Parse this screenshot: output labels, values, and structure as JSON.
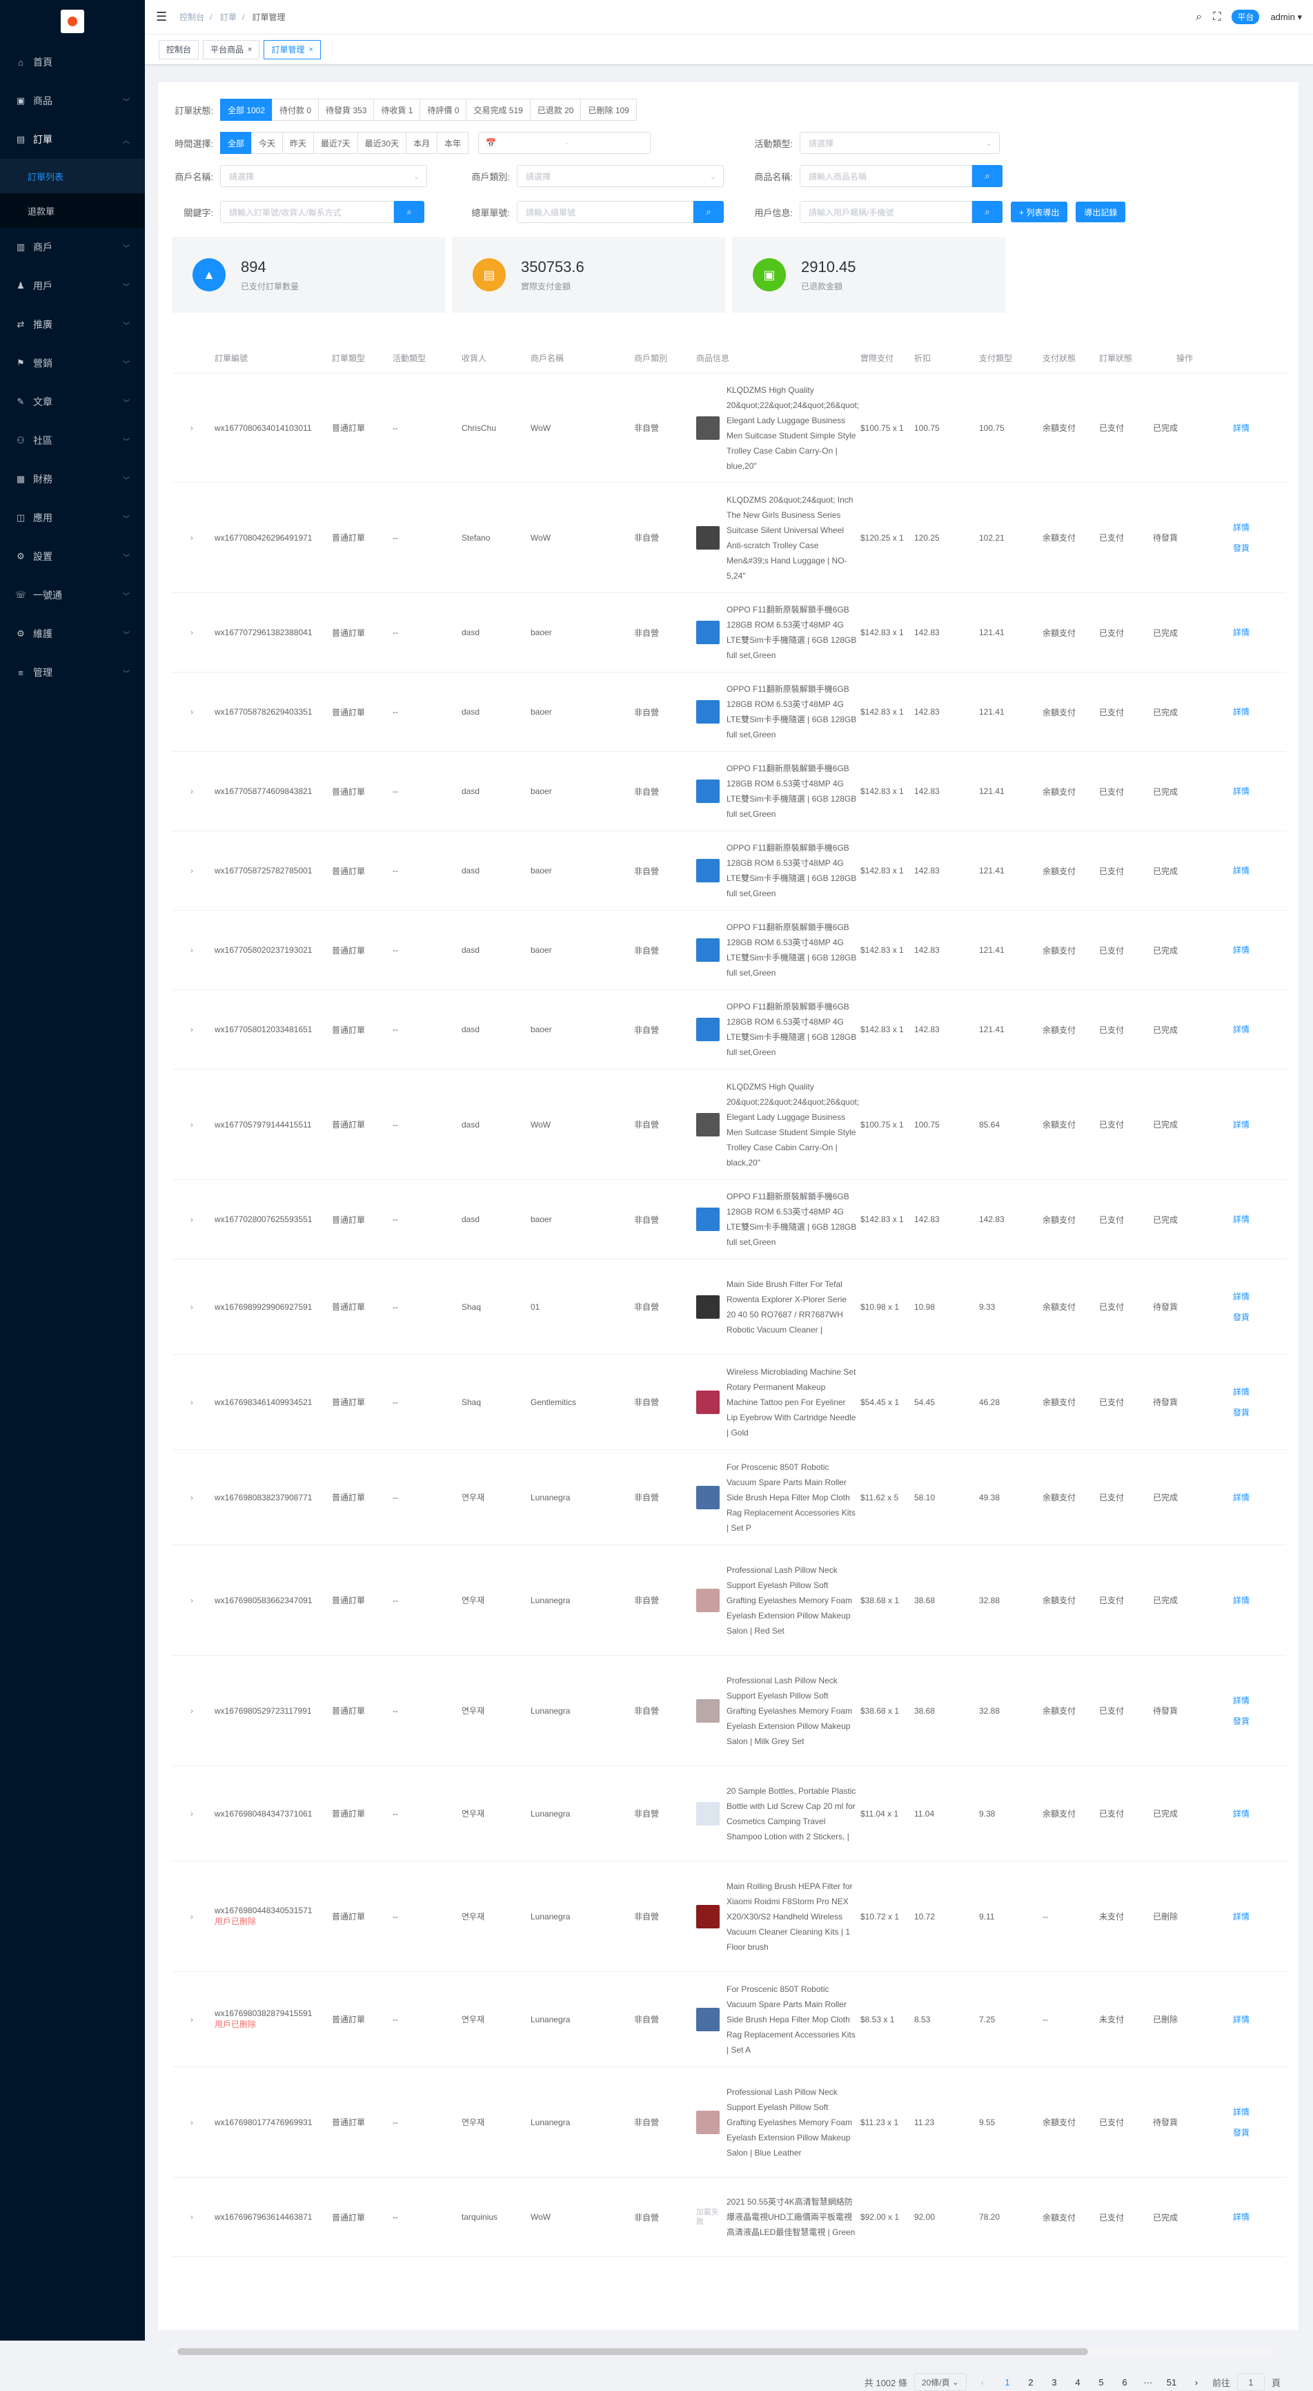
{
  "sidebar": {
    "items": [
      {
        "label": "首頁",
        "icon": "home-icon",
        "glyph": "⌂"
      },
      {
        "label": "商品",
        "icon": "goods-icon",
        "glyph": "▣"
      },
      {
        "label": "訂單",
        "icon": "order-icon",
        "glyph": "▤",
        "open": true,
        "children": [
          {
            "label": "訂單列表",
            "active": true
          },
          {
            "label": "退款單",
            "active": false
          }
        ]
      },
      {
        "label": "商戶",
        "icon": "merchant-icon",
        "glyph": "▥"
      },
      {
        "label": "用戶",
        "icon": "user-icon",
        "glyph": "♟"
      },
      {
        "label": "推廣",
        "icon": "promotion-icon",
        "glyph": "⇄"
      },
      {
        "label": "營銷",
        "icon": "marketing-icon",
        "glyph": "⚑"
      },
      {
        "label": "文章",
        "icon": "article-icon",
        "glyph": "✎"
      },
      {
        "label": "社區",
        "icon": "community-icon",
        "glyph": "⚇"
      },
      {
        "label": "財務",
        "icon": "finance-icon",
        "glyph": "▦"
      },
      {
        "label": "應用",
        "icon": "app-icon",
        "glyph": "◫"
      },
      {
        "label": "設置",
        "icon": "settings-icon",
        "glyph": "⚙"
      },
      {
        "label": "一號通",
        "icon": "phone-icon",
        "glyph": "☏"
      },
      {
        "label": "維護",
        "icon": "maintenance-icon",
        "glyph": "⚙"
      },
      {
        "label": "管理",
        "icon": "manage-icon",
        "glyph": "≡"
      }
    ]
  },
  "header": {
    "breadcrumb": [
      "控制台",
      "訂單",
      "訂單管理"
    ],
    "platform_badge": "平台",
    "username": "admin"
  },
  "tags": [
    {
      "label": "控制台",
      "closable": false,
      "active": false
    },
    {
      "label": "平台商品",
      "closable": true,
      "active": false
    },
    {
      "label": "訂單管理",
      "closable": true,
      "active": true
    }
  ],
  "filters": {
    "status_label": "訂單狀態:",
    "status_options": [
      "全部 1002",
      "待付款 0",
      "待發貨 353",
      "待收貨 1",
      "待評價 0",
      "交易完成 519",
      "已退款 20",
      "已刪除 109"
    ],
    "time_label": "時間選擇:",
    "time_options": [
      "全部",
      "今天",
      "昨天",
      "最近7天",
      "最近30天",
      "本月",
      "本年"
    ],
    "date_separator": "-",
    "activity_label": "活動類型:",
    "activity_placeholder": "請選擇",
    "merchant_label": "商戶名稱:",
    "merchant_placeholder": "請選擇",
    "merchant_cat_label": "商戶類別:",
    "merchant_cat_placeholder": "請選擇",
    "product_label": "商品名稱:",
    "product_placeholder": "請輸入商品名稱",
    "keyword_label": "關鍵字:",
    "keyword_placeholder": "請輸入訂單號/收貨人/聯系方式",
    "total_order_label": "總單單號:",
    "total_order_placeholder": "請輸入總單號",
    "user_info_label": "用戶信息:",
    "user_info_placeholder": "請輸入用戶暱稱/手機號",
    "export_list_btn": "+ 列表導出",
    "export_record_btn": "導出記錄"
  },
  "stats": [
    {
      "value": "894",
      "label": "已支付訂單數量",
      "color": "#1890ff",
      "icon": "bag-icon",
      "glyph": "▲"
    },
    {
      "value": "350753.6",
      "label": "實際支付金額",
      "color": "#f5a623",
      "icon": "wallet-icon",
      "glyph": "▤"
    },
    {
      "value": "2910.45",
      "label": "已退款金額",
      "color": "#52c41a",
      "icon": "refund-icon",
      "glyph": "▣"
    }
  ],
  "table": {
    "columns": [
      "訂單編號",
      "訂單類型",
      "活動類型",
      "收貨人",
      "商戶名稱",
      "商戶類別",
      "商品信息",
      "實際支付",
      "折扣",
      "支付類型",
      "支付狀態",
      "訂單狀態",
      "操作"
    ],
    "rows": [
      {
        "id": "wx1677080634014103011",
        "type": "普通訂單",
        "act": "--",
        "rec": "ChrisChu",
        "mer": "WoW",
        "cat": "非自營",
        "thumb": "#555",
        "info": "KLQDZMS High Quality 20&quot;22&quot;24&quot;26&quot; Elegant Lady Luggage Business Men Suitcase Student Simple Style Trolley Case Cabin Carry-On | blue,20\"",
        "price": "$100.75 x 1",
        "pay": "100.75",
        "disc": "100.75",
        "ptype": "余額支付",
        "pstat": "已支付",
        "ostat": "已完成",
        "ops": [
          "詳情"
        ],
        "h": 158
      },
      {
        "id": "wx1677080426296491971",
        "type": "普通訂單",
        "act": "--",
        "rec": "Stefano",
        "mer": "WoW",
        "cat": "非自營",
        "thumb": "#444",
        "info": "KLQDZMS 20&quot;24&quot; Inch The New Girls Business Series Suitcase Silent Universal Wheel Anti-scratch Trolley Case Men&#39;s Hand Luggage | NO-5,24\"",
        "price": "$120.25 x 1",
        "pay": "120.25",
        "disc": "102.21",
        "ptype": "余額支付",
        "pstat": "已支付",
        "ostat": "待發貨",
        "ops": [
          "詳情",
          "發貨"
        ],
        "h": 160
      },
      {
        "id": "wx1677072961382388041",
        "type": "普通訂單",
        "act": "--",
        "rec": "dasd",
        "mer": "baoer",
        "cat": "非自營",
        "thumb": "#2a7fd4",
        "info": "OPPO F11翻新原裝解鎖手機6GB 128GB ROM 6.53英寸48MP 4G LTE雙Sim卡手機隨選 | 6GB 128GB full set,Green",
        "price": "$142.83 x 1",
        "pay": "142.83",
        "disc": "121.41",
        "ptype": "余額支付",
        "pstat": "已支付",
        "ostat": "已完成",
        "ops": [
          "詳情"
        ],
        "h": 115
      },
      {
        "id": "wx1677058782629403351",
        "type": "普通訂單",
        "act": "--",
        "rec": "dasd",
        "mer": "baoer",
        "cat": "非自營",
        "thumb": "#2a7fd4",
        "info": "OPPO F11翻新原裝解鎖手機6GB 128GB ROM 6.53英寸48MP 4G LTE雙Sim卡手機隨選 | 6GB 128GB full set,Green",
        "price": "$142.83 x 1",
        "pay": "142.83",
        "disc": "121.41",
        "ptype": "余額支付",
        "pstat": "已支付",
        "ostat": "已完成",
        "ops": [
          "詳情"
        ],
        "h": 115
      },
      {
        "id": "wx1677058774609843821",
        "type": "普通訂單",
        "act": "--",
        "rec": "dasd",
        "mer": "baoer",
        "cat": "非自營",
        "thumb": "#2a7fd4",
        "info": "OPPO F11翻新原裝解鎖手機6GB 128GB ROM 6.53英寸48MP 4G LTE雙Sim卡手機隨選 | 6GB 128GB full set,Green",
        "price": "$142.83 x 1",
        "pay": "142.83",
        "disc": "121.41",
        "ptype": "余額支付",
        "pstat": "已支付",
        "ostat": "已完成",
        "ops": [
          "詳情"
        ],
        "h": 115
      },
      {
        "id": "wx1677058725782785001",
        "type": "普通訂單",
        "act": "--",
        "rec": "dasd",
        "mer": "baoer",
        "cat": "非自營",
        "thumb": "#2a7fd4",
        "info": "OPPO F11翻新原裝解鎖手機6GB 128GB ROM 6.53英寸48MP 4G LTE雙Sim卡手機隨選 | 6GB 128GB full set,Green",
        "price": "$142.83 x 1",
        "pay": "142.83",
        "disc": "121.41",
        "ptype": "余額支付",
        "pstat": "已支付",
        "ostat": "已完成",
        "ops": [
          "詳情"
        ],
        "h": 115
      },
      {
        "id": "wx1677058020237193021",
        "type": "普通訂單",
        "act": "--",
        "rec": "dasd",
        "mer": "baoer",
        "cat": "非自營",
        "thumb": "#2a7fd4",
        "info": "OPPO F11翻新原裝解鎖手機6GB 128GB ROM 6.53英寸48MP 4G LTE雙Sim卡手機隨選 | 6GB 128GB full set,Green",
        "price": "$142.83 x 1",
        "pay": "142.83",
        "disc": "121.41",
        "ptype": "余額支付",
        "pstat": "已支付",
        "ostat": "已完成",
        "ops": [
          "詳情"
        ],
        "h": 115
      },
      {
        "id": "wx1677058012033481651",
        "type": "普通訂單",
        "act": "--",
        "rec": "dasd",
        "mer": "baoer",
        "cat": "非自營",
        "thumb": "#2a7fd4",
        "info": "OPPO F11翻新原裝解鎖手機6GB 128GB ROM 6.53英寸48MP 4G LTE雙Sim卡手機隨選 | 6GB 128GB full set,Green",
        "price": "$142.83 x 1",
        "pay": "142.83",
        "disc": "121.41",
        "ptype": "余額支付",
        "pstat": "已支付",
        "ostat": "已完成",
        "ops": [
          "詳情"
        ],
        "h": 115
      },
      {
        "id": "wx1677057979144415511",
        "type": "普通訂單",
        "act": "--",
        "rec": "dasd",
        "mer": "WoW",
        "cat": "非自營",
        "thumb": "#555",
        "info": "KLQDZMS High Quality 20&quot;22&quot;24&quot;26&quot; Elegant Lady Luggage Business Men Suitcase Student Simple Style Trolley Case Cabin Carry-On | black,20\"",
        "price": "$100.75 x 1",
        "pay": "100.75",
        "disc": "85.64",
        "ptype": "余額支付",
        "pstat": "已支付",
        "ostat": "已完成",
        "ops": [
          "詳情"
        ],
        "h": 160
      },
      {
        "id": "wx1677028007625593551",
        "type": "普通訂單",
        "act": "--",
        "rec": "dasd",
        "mer": "baoer",
        "cat": "非自營",
        "thumb": "#2a7fd4",
        "info": "OPPO F11翻新原裝解鎖手機6GB 128GB ROM 6.53英寸48MP 4G LTE雙Sim卡手機隨選 | 6GB 128GB full set,Green",
        "price": "$142.83 x 1",
        "pay": "142.83",
        "disc": "142.83",
        "ptype": "余額支付",
        "pstat": "已支付",
        "ostat": "已完成",
        "ops": [
          "詳情"
        ],
        "h": 115
      },
      {
        "id": "wx1676989929906927591",
        "type": "普通訂單",
        "act": "--",
        "rec": "Shaq",
        "mer": "01",
        "cat": "非自營",
        "thumb": "#333",
        "info": "Main Side Brush Filter For Tefal Rowenta Explorer X-Plorer Serie 20 40 50 RO7687 / RR7687WH Robotic Vacuum Cleaner |",
        "price": "$10.98 x 1",
        "pay": "10.98",
        "disc": "9.33",
        "ptype": "余額支付",
        "pstat": "已支付",
        "ostat": "待發貨",
        "ops": [
          "詳情",
          "發貨"
        ],
        "h": 138
      },
      {
        "id": "wx1676983461409934521",
        "type": "普通訂單",
        "act": "--",
        "rec": "Shaq",
        "mer": "Gentlemitics",
        "cat": "非自營",
        "thumb": "#b03050",
        "info": "Wireless Microblading Machine Set Rotary Permanent Makeup Machine Tattoo pen For Eyeliner Lip Eyebrow With Cartridge Needle | Gold",
        "price": "$54.45 x 1",
        "pay": "54.45",
        "disc": "46.28",
        "ptype": "余額支付",
        "pstat": "已支付",
        "ostat": "待發貨",
        "ops": [
          "詳情",
          "發貨"
        ],
        "h": 138
      },
      {
        "id": "wx1676980838237908771",
        "type": "普通訂單",
        "act": "--",
        "rec": "연우재",
        "mer": "Lunanegra",
        "cat": "非自營",
        "thumb": "#4a6fa5",
        "info": "For Proscenic 850T Robotic Vacuum Spare Parts Main Roller Side Brush Hepa Filter Mop Cloth Rag Replacement Accessories Kits | Set P",
        "price": "$11.62 x 5",
        "pay": "58.10",
        "disc": "49.38",
        "ptype": "余額支付",
        "pstat": "已支付",
        "ostat": "已完成",
        "ops": [
          "詳情"
        ],
        "h": 138
      },
      {
        "id": "wx1676980583662347091",
        "type": "普通訂單",
        "act": "--",
        "rec": "연우재",
        "mer": "Lunanegra",
        "cat": "非自營",
        "thumb": "#c9a0a0",
        "info": "Professional Lash Pillow Neck Support Eyelash Pillow Soft Grafting Eyelashes Memory Foam Eyelash Extension Pillow Makeup Salon | Red Set",
        "price": "$38.68 x 1",
        "pay": "38.68",
        "disc": "32.88",
        "ptype": "余額支付",
        "pstat": "已支付",
        "ostat": "已完成",
        "ops": [
          "詳情"
        ],
        "h": 160
      },
      {
        "id": "wx1676980529723117991",
        "type": "普通訂單",
        "act": "--",
        "rec": "연우재",
        "mer": "Lunanegra",
        "cat": "非自營",
        "thumb": "#b8a8a8",
        "info": "Professional Lash Pillow Neck Support Eyelash Pillow Soft Grafting Eyelashes Memory Foam Eyelash Extension Pillow Makeup Salon | Milk Grey Set",
        "price": "$38.68 x 1",
        "pay": "38.68",
        "disc": "32.88",
        "ptype": "余額支付",
        "pstat": "已支付",
        "ostat": "待發貨",
        "ops": [
          "詳情",
          "發貨"
        ],
        "h": 160
      },
      {
        "id": "wx1676980484347371061",
        "type": "普通訂單",
        "act": "--",
        "rec": "연우재",
        "mer": "Lunanegra",
        "cat": "非自營",
        "thumb": "#dde6ee",
        "info": "20 Sample Bottles, Portable Plastic Bottle with Lid Screw Cap 20 ml for Cosmetics Camping Travel Shampoo Lotion with 2 Stickers, |",
        "price": "$11.04 x 1",
        "pay": "11.04",
        "disc": "9.38",
        "ptype": "余額支付",
        "pstat": "已支付",
        "ostat": "已完成",
        "ops": [
          "詳情"
        ],
        "h": 138
      },
      {
        "id": "wx1676980448340531571",
        "deleted": "用戶已刪除",
        "type": "普通訂單",
        "act": "--",
        "rec": "연우재",
        "mer": "Lunanegra",
        "cat": "非自營",
        "thumb": "#8b1a1a",
        "info": "Main Rolling Brush HEPA Filter for Xiaomi Roidmi F8Storm Pro NEX X20/X30/S2 Handheld Wireless Vacuum Cleaner Cleaning Kits | 1 Floor brush",
        "price": "$10.72 x 1",
        "pay": "10.72",
        "disc": "9.11",
        "ptype": "--",
        "pstat": "未支付",
        "ostat": "已刪除",
        "ops": [
          "詳情"
        ],
        "h": 160
      },
      {
        "id": "wx1676980382879415591",
        "deleted": "用戶已刪除",
        "type": "普通訂單",
        "act": "--",
        "rec": "연우재",
        "mer": "Lunanegra",
        "cat": "非自營",
        "thumb": "#4a6fa5",
        "info": "For Proscenic 850T Robotic Vacuum Spare Parts Main Roller Side Brush Hepa Filter Mop Cloth Rag Replacement Accessories Kits | Set A",
        "price": "$8.53 x 1",
        "pay": "8.53",
        "disc": "7.25",
        "ptype": "--",
        "pstat": "未支付",
        "ostat": "已刪除",
        "ops": [
          "詳情"
        ],
        "h": 138
      },
      {
        "id": "wx1676980177476969931",
        "type": "普通訂單",
        "act": "--",
        "rec": "연우재",
        "mer": "Lunanegra",
        "cat": "非自營",
        "thumb": "#c9a0a0",
        "info": "Professional Lash Pillow Neck Support Eyelash Pillow Soft Grafting Eyelashes Memory Foam Eyelash Extension Pillow Makeup Salon | Blue Leather",
        "price": "$11.23 x 1",
        "pay": "11.23",
        "disc": "9.55",
        "ptype": "余額支付",
        "pstat": "已支付",
        "ostat": "待發貨",
        "ops": [
          "詳情",
          "發貨"
        ],
        "h": 160
      },
      {
        "id": "wx1676967963614463871",
        "type": "普通訂單",
        "act": "--",
        "rec": "tarquinius",
        "mer": "WoW",
        "cat": "非自營",
        "thumb_text": "加載失敗",
        "info": "2021 50.55英寸4K高清智慧網絡防爆液晶電視UHD工廠價兩平板電視高清液晶LED最佳智慧電視 | Green",
        "price": "$92.00 x 1",
        "pay": "92.00",
        "disc": "78.20",
        "ptype": "余額支付",
        "pstat": "已支付",
        "ostat": "已完成",
        "ops": [
          "詳情"
        ],
        "h": 115
      }
    ]
  },
  "pagination": {
    "total": "共 1002 條",
    "size": "20條/頁",
    "prev": "‹",
    "pages": [
      "1",
      "2",
      "3",
      "4",
      "5",
      "6",
      "···",
      "51"
    ],
    "next": "›",
    "goto_label": "前往",
    "goto_value": "1",
    "page_unit": "頁"
  }
}
